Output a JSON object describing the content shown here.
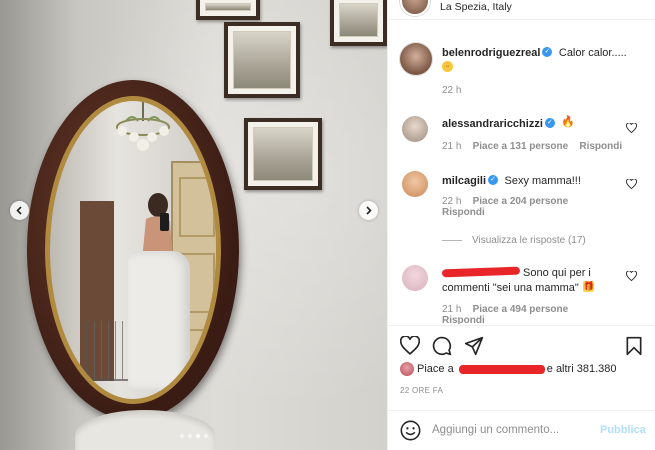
{
  "post": {
    "location": "La Spezia, Italy",
    "author": "belenrodriguezreal",
    "caption": "Calor calor.....",
    "caption_time": "22 h",
    "carousel": {
      "total_slides": 4,
      "active_slide": 3
    }
  },
  "comments": [
    {
      "username": "alessandraricchizzi",
      "verified": true,
      "text": "",
      "time": "21 h",
      "likes": "Piace a 131 persone",
      "reply": "Rispondi"
    },
    {
      "username": "milcagili",
      "verified": true,
      "text": "Sexy mamma!!!",
      "time": "22 h",
      "likes": "Piace a 204 persone",
      "reply": "Rispondi"
    },
    {
      "view_replies": "Visualizza le risposte (17)"
    },
    {
      "username": "",
      "verified": false,
      "text": "Sono qui per i commenti \"sei una mamma\"",
      "time": "21 h",
      "likes": "Piace a 494 persone",
      "reply": "Rispondi"
    }
  ],
  "actions": {
    "likes_prefix": "Piace a",
    "likes_suffix": "e altri 381.380",
    "post_time": "22 ORE FA"
  },
  "composer": {
    "placeholder": "Aggiungi un commento...",
    "publish_label": "Pubblica"
  },
  "colors": {
    "verified": "#3897f0",
    "publish_disabled": "#b2dffc",
    "redaction": "#e8262a",
    "muted": "#8e8e8e"
  },
  "icons": [
    "verified-badge-icon",
    "heart-icon",
    "comment-icon",
    "share-icon",
    "bookmark-icon",
    "smile-icon",
    "chevron-left-icon",
    "chevron-right-icon"
  ]
}
